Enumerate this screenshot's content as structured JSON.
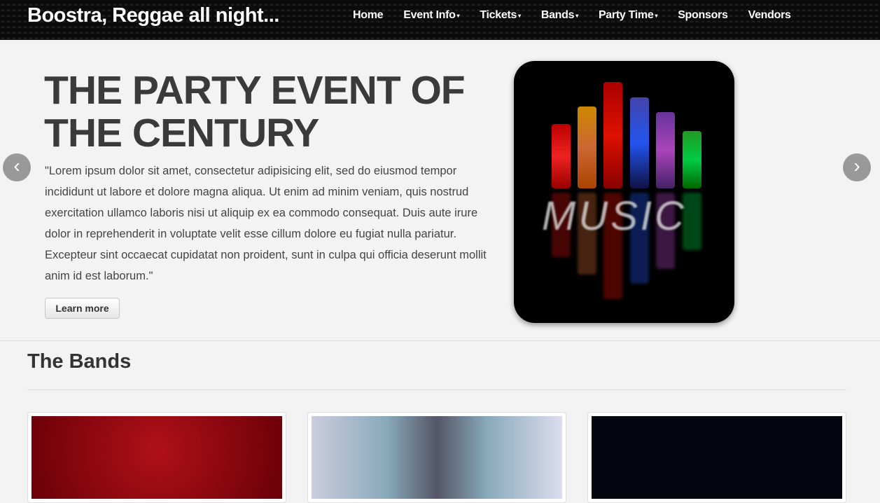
{
  "navbar": {
    "brand": "Boostra, Reggae all night...",
    "items": [
      {
        "label": "Home",
        "dropdown": false
      },
      {
        "label": "Event Info",
        "dropdown": true
      },
      {
        "label": "Tickets",
        "dropdown": true
      },
      {
        "label": "Bands",
        "dropdown": true
      },
      {
        "label": "Party Time",
        "dropdown": true
      },
      {
        "label": "Sponsors",
        "dropdown": false
      },
      {
        "label": "Vendors",
        "dropdown": false
      }
    ],
    "caret": "▾"
  },
  "hero": {
    "title": "THE PARTY EVENT OF THE CENTURY",
    "text": "\"Lorem ipsum dolor sit amet, consectetur adipisicing elit, sed do eiusmod tempor incididunt ut labore et dolore magna aliqua. Ut enim ad minim veniam, quis nostrud exercitation ullamco laboris nisi ut aliquip ex ea commodo consequat. Duis aute irure dolor in reprehenderit in voluptate velit esse cillum dolore eu fugiat nulla pariatur. Excepteur sint occaecat cupidatat non proident, sunt in culpa qui officia deserunt mollit anim id est laborum.\"",
    "button": "Learn more",
    "prev": "‹",
    "next": "›",
    "image_text": "MUSIC"
  },
  "bands": {
    "title": "The Bands"
  }
}
